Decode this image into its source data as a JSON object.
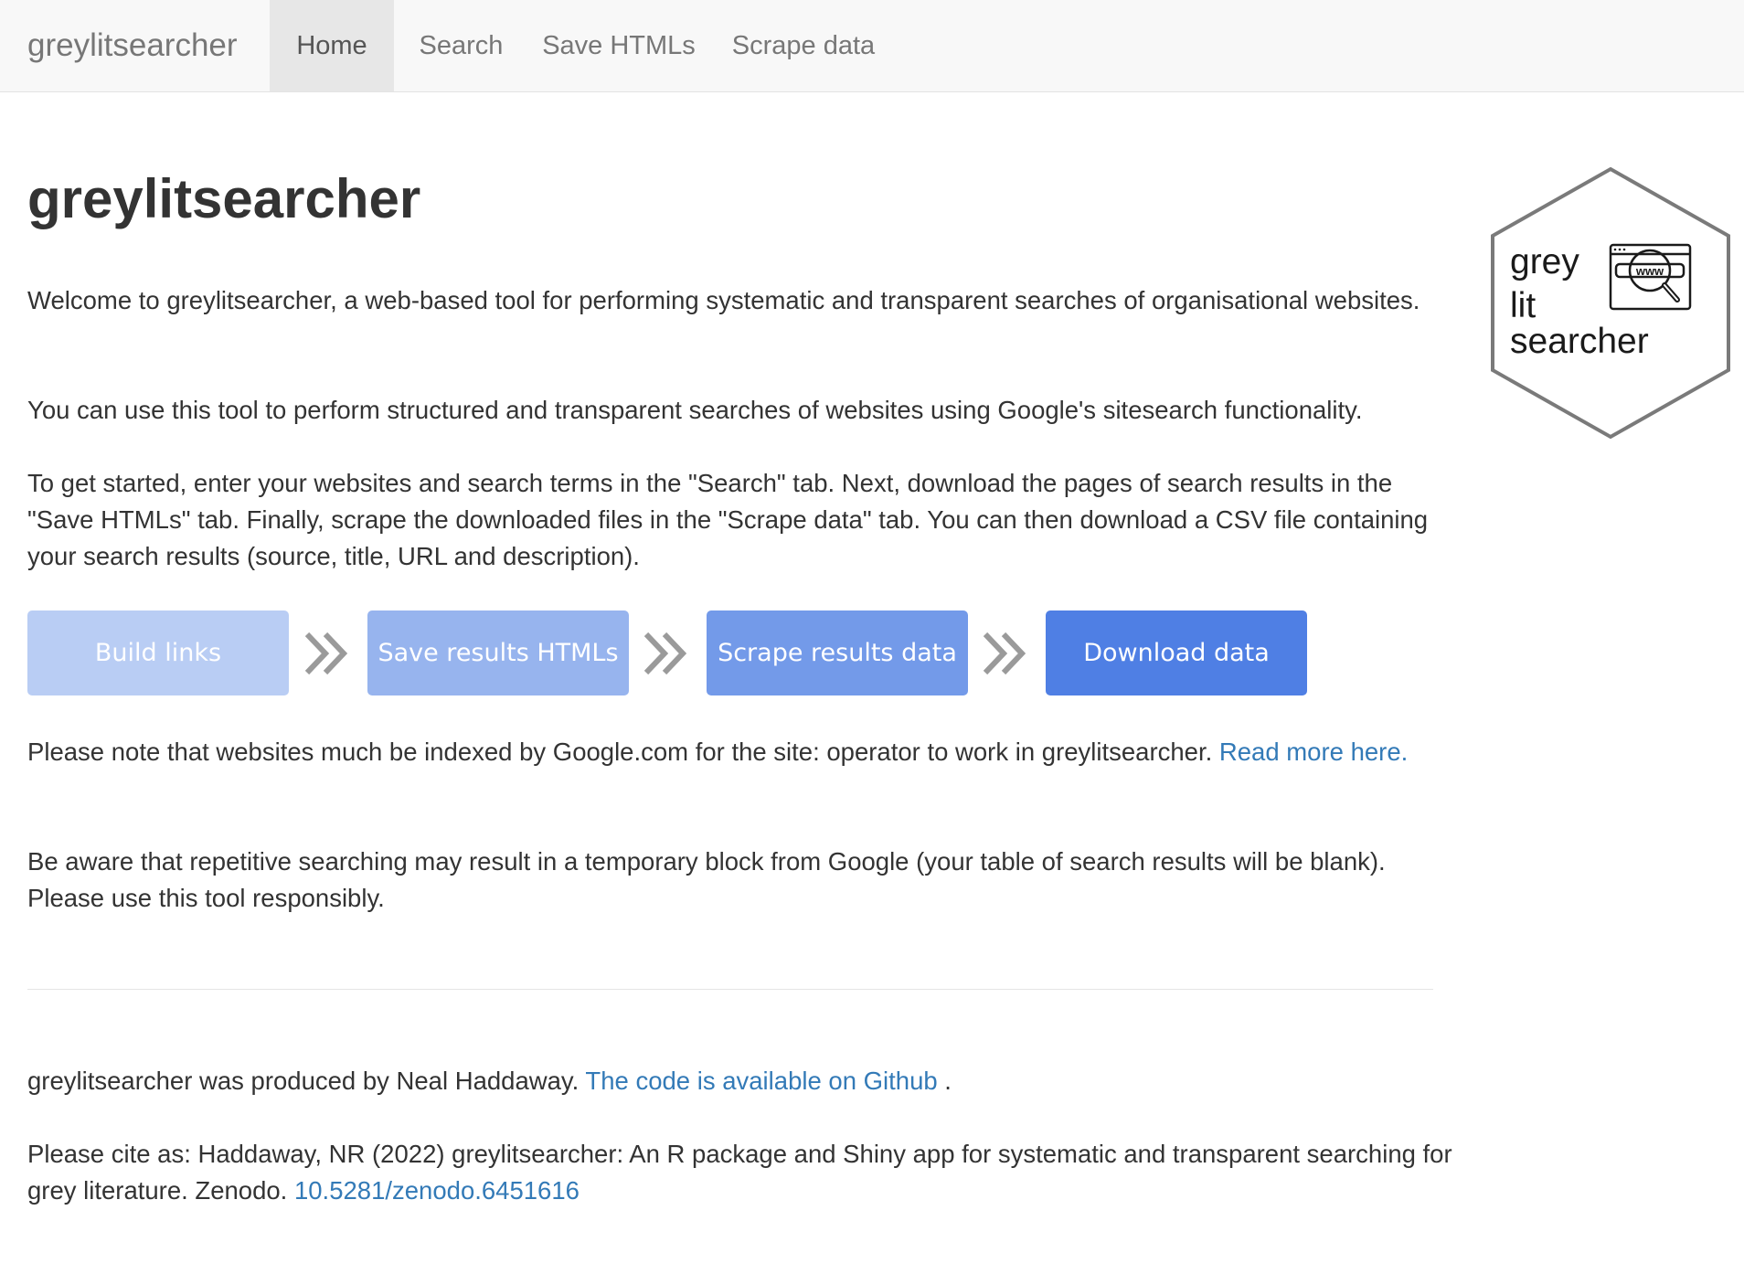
{
  "navbar": {
    "brand": "greylitsearcher",
    "items": [
      {
        "label": "Home",
        "active": true
      },
      {
        "label": "Search",
        "active": false
      },
      {
        "label": "Save HTMLs",
        "active": false
      },
      {
        "label": "Scrape data",
        "active": false
      }
    ]
  },
  "main": {
    "title": "greylitsearcher",
    "intro": "Welcome to greylitsearcher, a web-based tool for performing systematic and transparent searches of organisational websites.",
    "usage": "You can use this tool to perform structured and transparent searches of websites using Google's sitesearch functionality.",
    "getting_started": "To get started, enter your websites and search terms in the \"Search\" tab. Next, download the pages of search results in the \"Save HTMLs\" tab. Finally, scrape the downloaded files in the \"Scrape data\" tab. You can then download a CSV file containing your search results (source, title, URL and description).",
    "steps": [
      {
        "label": "Build links",
        "color": "#b9cdf4"
      },
      {
        "label": "Save results HTMLs",
        "color": "#97b4ee"
      },
      {
        "label": "Scrape results data",
        "color": "#739ae9"
      },
      {
        "label": "Download data",
        "color": "#4f7fe4"
      }
    ],
    "note_text": "Please note that websites much be indexed by Google.com for the site: operator to work in greylitsearcher. ",
    "note_link": "Read more here.",
    "warning": "Be aware that repetitive searching may result in a temporary block from Google (your table of search results will be blank). Please use this tool responsibly."
  },
  "logo": {
    "line1": "grey",
    "line2": "lit",
    "line3": "searcher",
    "badge": "www",
    "icon": "web-search-icon"
  },
  "footer": {
    "credit_text": "greylitsearcher was produced by Neal Haddaway. ",
    "credit_link": "The code is available on Github",
    "credit_end": " .",
    "cite_text": "Please cite as: Haddaway, NR (2022) greylitsearcher: An R package and Shiny app for systematic and transparent searching for grey literature. Zenodo. ",
    "cite_link": "10.5281/zenodo.6451616"
  },
  "colors": {
    "link": "#337ab7",
    "navbar_bg": "#f8f8f8",
    "nav_active_bg": "#e7e7e7"
  }
}
